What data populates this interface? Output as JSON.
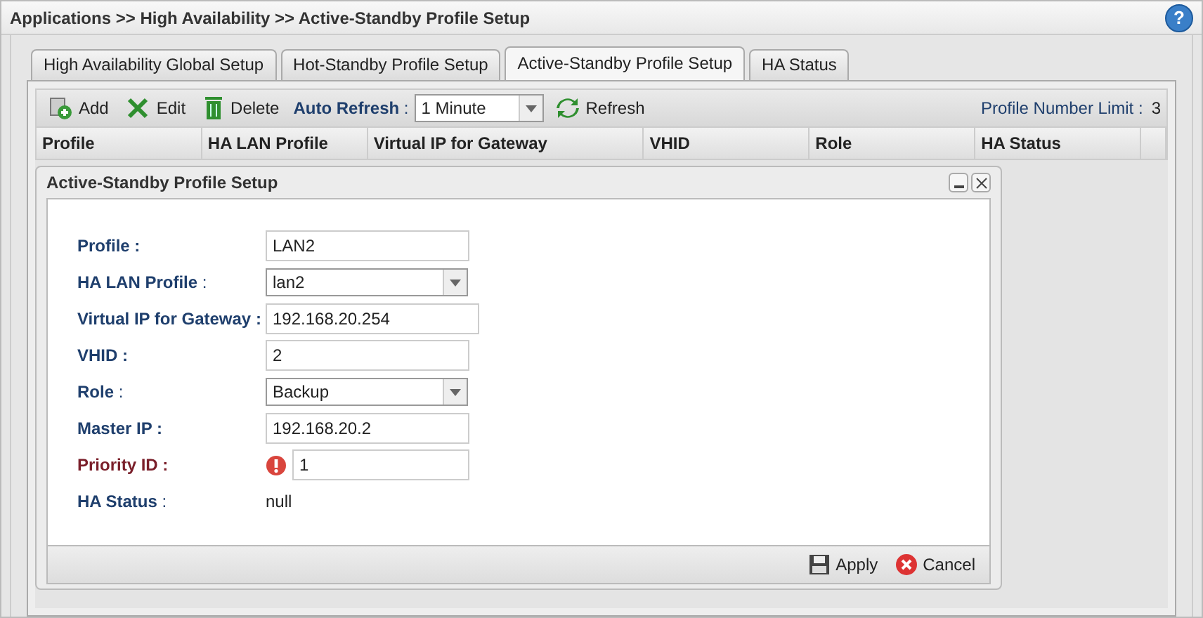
{
  "breadcrumb": "Applications >> High Availability >> Active-Standby Profile Setup",
  "help": "?",
  "tabs": [
    {
      "label": "High Availability Global Setup",
      "selected": false
    },
    {
      "label": "Hot-Standby Profile Setup",
      "selected": false
    },
    {
      "label": "Active-Standby Profile Setup",
      "selected": true
    },
    {
      "label": "HA Status",
      "selected": false
    }
  ],
  "toolbar": {
    "add": "Add",
    "edit": "Edit",
    "delete": "Delete",
    "auto_refresh_label": "**Auto Refresh** :",
    "auto_refresh_value": "1 Minute",
    "refresh": "Refresh",
    "limit_label": "Profile Number Limit :",
    "limit_value": "3"
  },
  "table": {
    "columns": [
      "Profile",
      "HA LAN Profile",
      "Virtual IP for Gateway",
      "VHID",
      "Role",
      "HA Status"
    ]
  },
  "dialog": {
    "title": "Active-Standby Profile Setup",
    "fields": [
      {
        "label": "**Profile :**",
        "kind": "text",
        "value": "LAN2",
        "error": false
      },
      {
        "label": "**HA LAN Profile** :",
        "kind": "select",
        "value": "lan2",
        "error": false
      },
      {
        "label": "**Virtual IP for Gateway :**",
        "kind": "text",
        "value": "192.168.20.254",
        "error": false
      },
      {
        "label": "**VHID :**",
        "kind": "text",
        "value": "2",
        "error": false
      },
      {
        "label": "**Role** :",
        "kind": "select",
        "value": "Backup",
        "error": false
      },
      {
        "label": "**Master IP :**",
        "kind": "text",
        "value": "192.168.20.2",
        "error": false
      },
      {
        "label": "**Priority ID :**",
        "kind": "text",
        "value": "1",
        "error": true
      },
      {
        "label": "**HA Status** :",
        "kind": "static",
        "value": "null",
        "error": false
      }
    ],
    "apply": "Apply",
    "cancel": "Cancel"
  }
}
